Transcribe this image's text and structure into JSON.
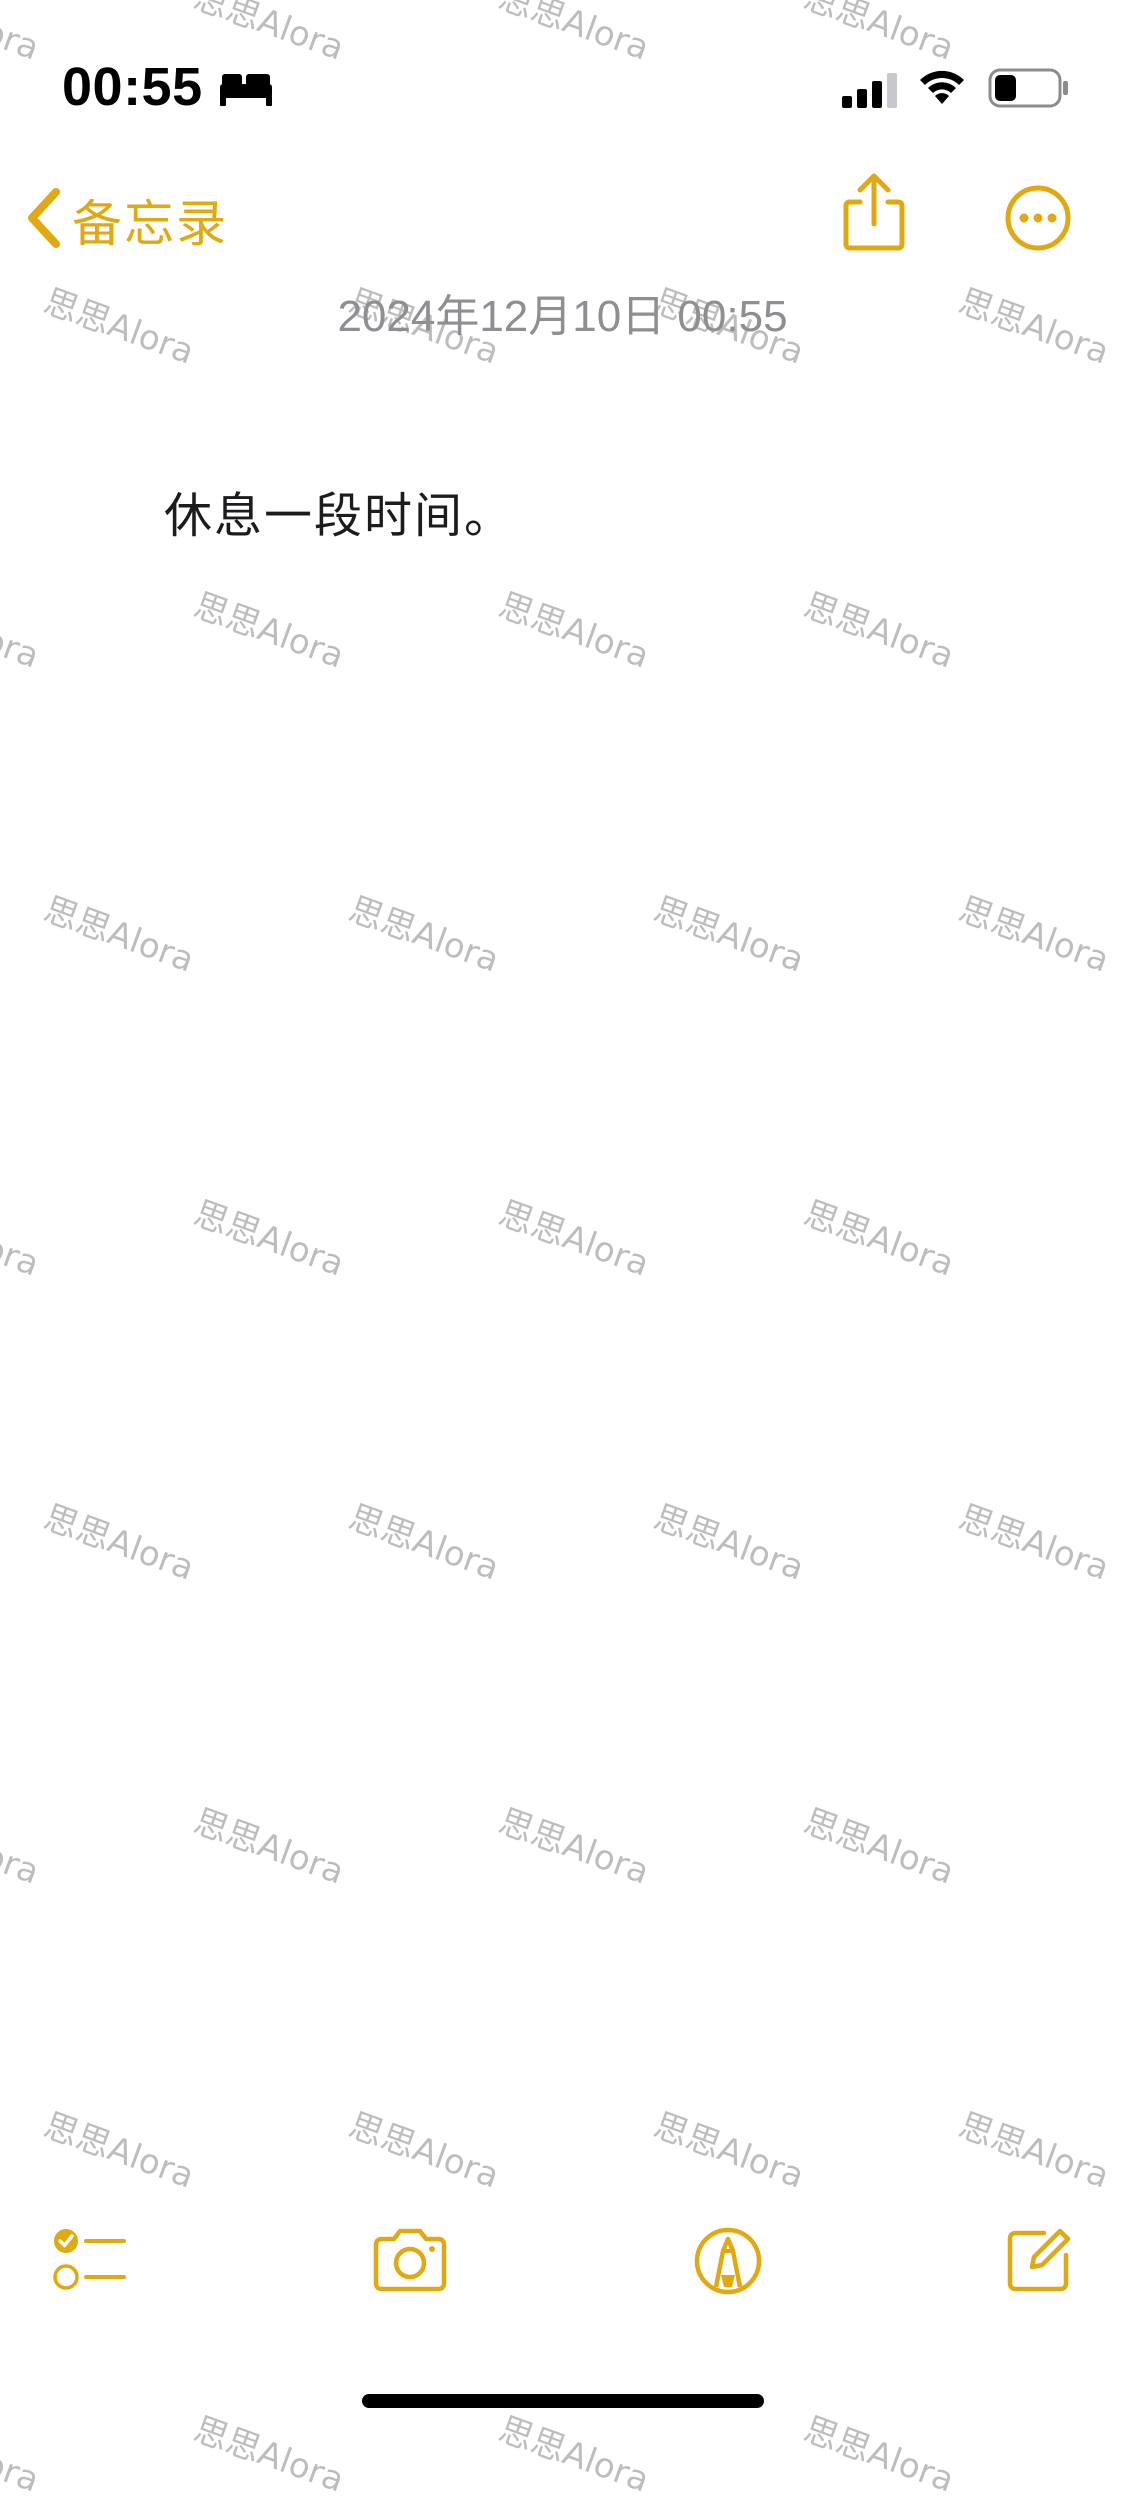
{
  "status_bar": {
    "time": "00:55",
    "focus_icon": "bed-icon",
    "signal_icon": "cellular-signal-icon",
    "wifi_icon": "wifi-icon",
    "battery_icon": "battery-icon",
    "battery_level": 0.35
  },
  "nav": {
    "back_label": "备忘录",
    "share_icon": "share-icon",
    "more_icon": "more-icon"
  },
  "note": {
    "date": "2024年12月10日 00:55",
    "body": "休息一段时间。"
  },
  "toolbar": {
    "checklist_icon": "checklist-icon",
    "camera_icon": "camera-icon",
    "markup_icon": "markup-icon",
    "compose_icon": "compose-icon"
  },
  "watermark": {
    "text": "思思Alora"
  },
  "colors": {
    "accent": "#e1a80f",
    "date_text": "#8e8e93",
    "body_text": "#1c1c1e",
    "watermark": "#bdbdbd"
  }
}
